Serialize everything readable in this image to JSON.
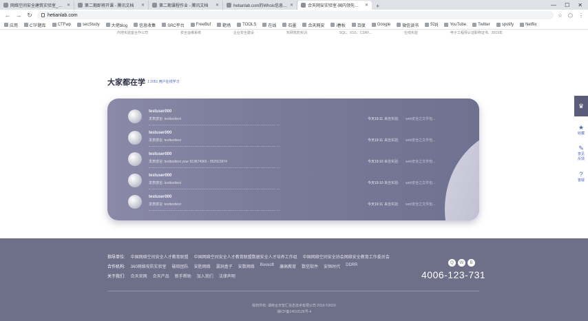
{
  "browser": {
    "tabs": [
      {
        "title": "网络空间安全建筑实验室_网络..."
      },
      {
        "title": "第二期即将开课 - 腾讯文档"
      },
      {
        "title": "第二期课程作业 - 腾讯文档"
      },
      {
        "title": "hetianlab.com的Whois信息 - S..."
      },
      {
        "title": "合天网安实验室-国内领先的MOOC...",
        "active": true
      }
    ],
    "url": "hetianlab.com",
    "bookmarks": [
      "应用",
      "CTF题库",
      "CTFwp",
      "secStudy",
      "大佬blog",
      "信息收集",
      "SRC平台",
      "FreeBuf",
      "靶场",
      "TOOLS",
      "在线",
      "石墨",
      "合天网安",
      "i春秋",
      "百度",
      "Google",
      "微信读书",
      "52pj",
      "YouTube",
      "Twitter",
      "spotify",
      "Netflix"
    ]
  },
  "partners_strip": [
    "内地实验室合作公司",
    "安全运维系统",
    "企业安全建设",
    "实网攻防实训",
    "SQL、XSS、CSRF...",
    "在线实验",
    "电子工程师认证职称证书、2019年"
  ],
  "section": {
    "title": "大家都在学",
    "subtitle": "1  2051 用户在线学习"
  },
  "learners": [
    {
      "name": "testuser000",
      "sign": "发表感言: testtesttest",
      "time": "今天19:11",
      "lab_label": "来自实验:",
      "lab": "web安全之文件包..."
    },
    {
      "name": "testuser000",
      "sign": "发表感言: testtesttest",
      "time": "今天19:11",
      "lab_label": "来自实验:",
      "lab": "web安全之文件包..."
    },
    {
      "name": "testuser000",
      "sign": "发表感言: testtesttest your 919874965 - 952923974",
      "time": "今天19:10",
      "lab_label": "来自实验:",
      "lab": "web安全之文件包..."
    },
    {
      "name": "testuser000",
      "sign": "发表感言: testtesttest",
      "time": "今天19:10",
      "lab_label": "来自实验:",
      "lab": "web安全之文件包..."
    },
    {
      "name": "testuser000",
      "sign": "发表感言: testtesttest",
      "time": "今天19:11",
      "lab_label": "来自实验:",
      "lab": "web安全之文件包..."
    }
  ],
  "sidebar": [
    {
      "icon": "crown-icon",
      "glyph": "♛",
      "label": "",
      "dark": true
    },
    {
      "icon": "star-icon",
      "glyph": "★",
      "label": "收藏"
    },
    {
      "icon": "feedback-icon",
      "glyph": "✎",
      "label": "意见\n反馈"
    },
    {
      "icon": "faq-icon",
      "glyph": "?",
      "label": "答疑"
    }
  ],
  "footer": {
    "guide_label": "指导单位:",
    "guide_items": [
      "中国网络空间安全人才教育联盟",
      "中国网络空间安全人才教育联盟数据安全人才培养工作组",
      "中国网络空间安全协会网络安全教育工作委员会"
    ],
    "partner_label": "合作机构:",
    "partner_items": [
      "360网络攻防实验室",
      "破晓团队",
      "安胜网络",
      "漏洞盒子",
      "安数网络",
      "Boosoft",
      "康高教育",
      "数信软件",
      "安恒时代",
      "DDRR"
    ],
    "about_label": "关于我们:",
    "about_items": [
      "合天官网",
      "合天产品",
      "新手帮助",
      "加入我们",
      "法律声明"
    ],
    "social": [
      "qq-icon",
      "wechat-icon",
      "weibo-icon"
    ],
    "phone": "4006-123-731",
    "copyright": "版权所有: 湖南合天智汇信息技术有限公司 2019 ©2020",
    "icp": "湘ICP备14010126号-4"
  },
  "colors": {
    "card": "#76789a",
    "footer": "#6e7089",
    "accent": "#4e63c9"
  }
}
